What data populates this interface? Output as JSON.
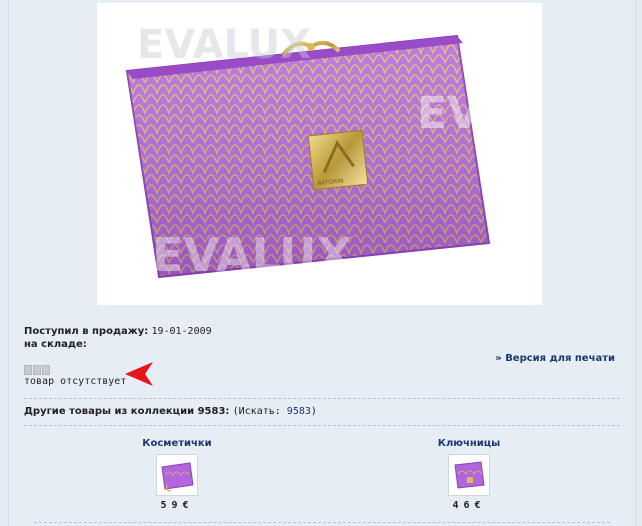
{
  "product": {
    "image_alt": "purple wallet",
    "watermark": "EVALUX",
    "clasp_brand": "AKTORIN"
  },
  "info": {
    "on_sale_label": "Поступил в продажу:",
    "on_sale_date": "19-01-2009",
    "in_stock_label": "на складе:",
    "stock_status": "товар отсутствует"
  },
  "print_link": "Версия для печати",
  "collection": {
    "label": "Другие товары из коллекции 9583:",
    "search_prefix": "(Искать: ",
    "search_link": "9583",
    "search_suffix": ")"
  },
  "related": [
    {
      "name": "Косметички",
      "price": "59€"
    },
    {
      "name": "Ключницы",
      "price": "46€"
    }
  ],
  "colors": {
    "background": "#e4ebf2",
    "link": "#1a3a6e",
    "product": "#b05cd6",
    "arrow": "#e8141c"
  }
}
